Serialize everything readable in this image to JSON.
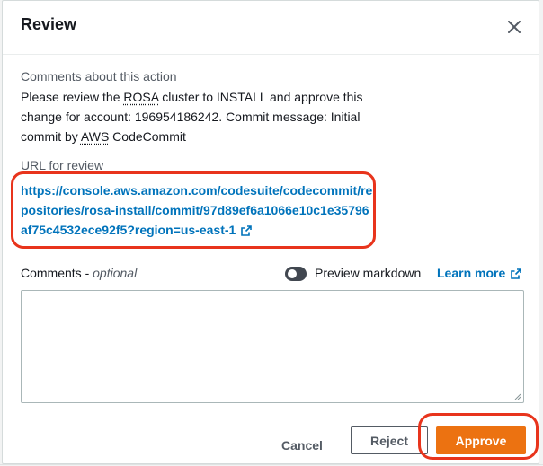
{
  "modal": {
    "title": "Review"
  },
  "action": {
    "comments_label": "Comments about this action",
    "text_before": "Please review the ",
    "abbr_1": "ROSA",
    "text_middle": " cluster to INSTALL and approve this change for account: 196954186242. Commit message: Initial commit by ",
    "abbr_2": "AWS",
    "text_after": " CodeCommit"
  },
  "review": {
    "url_label": "URL for review",
    "url": "https://console.aws.amazon.com/codesuite/codecommit/repositories/rosa-install/commit/97d89ef6a1066e10c1e35796af75c4532ece92f5?region=us-east-1"
  },
  "comments": {
    "label": "Comments",
    "optional": "optional",
    "separator": " - ",
    "value": "",
    "preview_label": "Preview markdown",
    "preview_enabled": false,
    "learn_more": "Learn more"
  },
  "footer": {
    "cancel": "Cancel",
    "reject": "Reject",
    "approve": "Approve"
  },
  "colors": {
    "accent": "#ec7211",
    "link": "#0073bb",
    "highlight": "#e8341c"
  },
  "icons": {
    "close": "close-icon",
    "external": "external-link-icon",
    "resize": "resize-grip-icon"
  }
}
